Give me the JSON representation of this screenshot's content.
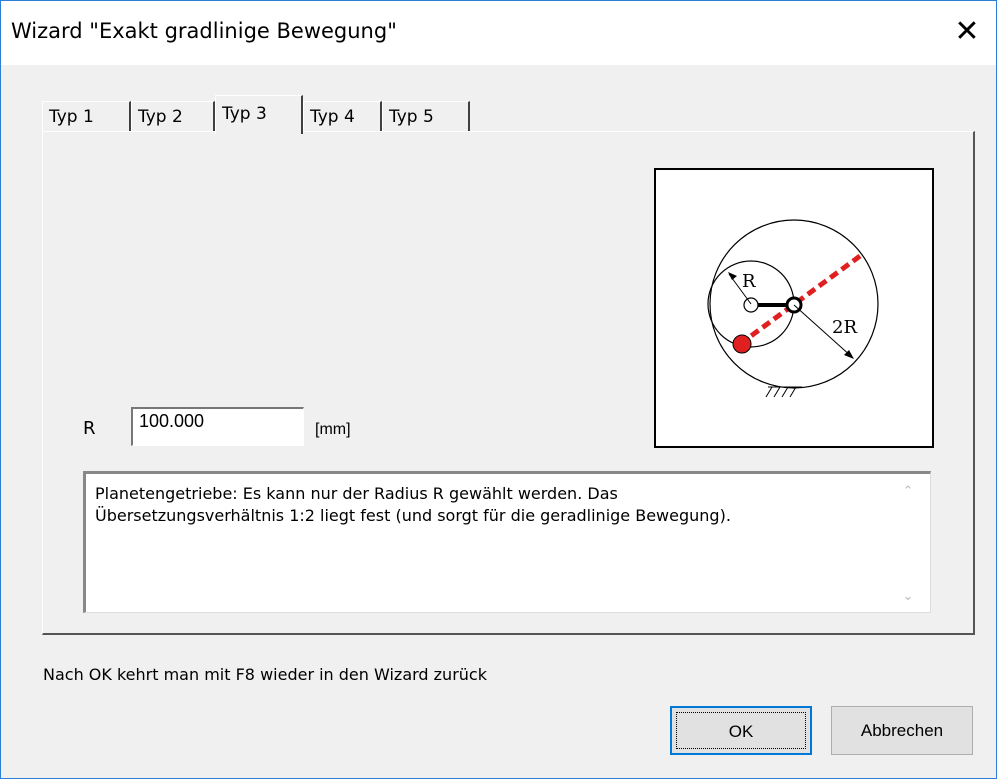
{
  "window": {
    "title": "Wizard \"Exakt gradlinige Bewegung\"",
    "close_symbol": "✕"
  },
  "tabs": [
    {
      "label": "Typ 1",
      "active": false
    },
    {
      "label": "Typ 2",
      "active": false
    },
    {
      "label": "Typ 3",
      "active": true
    },
    {
      "label": "Typ 4",
      "active": false
    },
    {
      "label": "Typ 5",
      "active": false
    }
  ],
  "diagram": {
    "label_r": "R",
    "label_2r": "2R"
  },
  "param": {
    "label": "R",
    "value": "100.000",
    "unit": "[mm]"
  },
  "description": "Planetengetriebe: Es kann nur der Radius R gewählt werden. Das\nÜbersetzungsverhältnis 1:2 liegt fest (und sorgt für die geradlinige Bewegung).",
  "footer_note": "Nach OK kehrt man mit F8 wieder in den Wizard zurück",
  "buttons": {
    "ok": "OK",
    "cancel": "Abbrechen"
  },
  "colors": {
    "accent_border": "#2b7fd8",
    "path_red": "#e02020"
  }
}
